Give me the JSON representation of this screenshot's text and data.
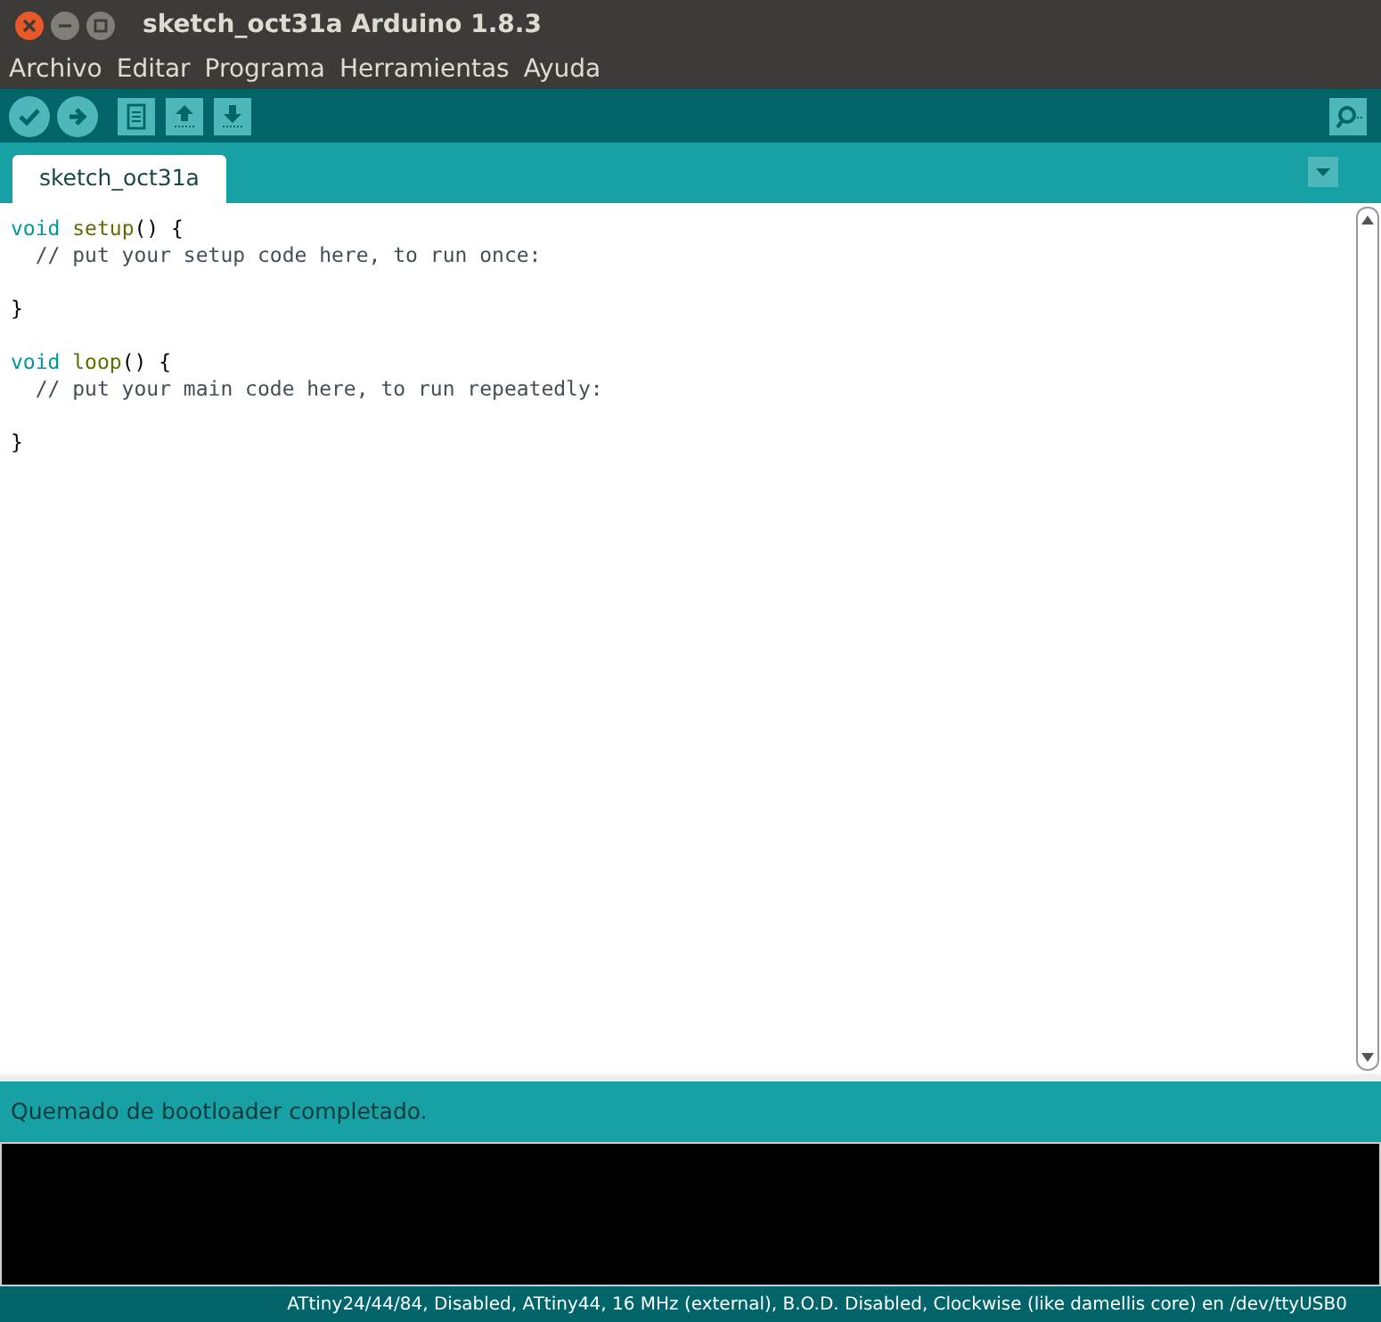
{
  "window": {
    "title": "sketch_oct31a Arduino 1.8.3"
  },
  "menu": [
    {
      "label": "Archivo"
    },
    {
      "label": "Editar"
    },
    {
      "label": "Programa"
    },
    {
      "label": "Herramientas"
    },
    {
      "label": "Ayuda"
    }
  ],
  "tabs": [
    {
      "label": "sketch_oct31a",
      "selected": true
    }
  ],
  "editor": {
    "tokens": [
      {
        "kind": "keyword",
        "text": "void"
      },
      {
        "kind": "function",
        "text": " setup"
      },
      {
        "kind": "plain",
        "text": "() {"
      },
      {
        "kind": "newline"
      },
      {
        "kind": "comment",
        "text": "  // put your setup code here, to run once:"
      },
      {
        "kind": "newline"
      },
      {
        "kind": "newline"
      },
      {
        "kind": "plain",
        "text": "}"
      },
      {
        "kind": "newline"
      },
      {
        "kind": "newline"
      },
      {
        "kind": "keyword",
        "text": "void"
      },
      {
        "kind": "function",
        "text": " loop"
      },
      {
        "kind": "plain",
        "text": "() {"
      },
      {
        "kind": "newline"
      },
      {
        "kind": "comment",
        "text": "  // put your main code here, to run repeatedly:"
      },
      {
        "kind": "newline"
      },
      {
        "kind": "newline"
      },
      {
        "kind": "plain",
        "text": "}"
      }
    ]
  },
  "status": {
    "message": "Quemado de bootloader completado."
  },
  "footer": {
    "board": "ATtiny24/44/84, Disabled, ATtiny44, 16 MHz (external), B.O.D. Disabled, Clockwise (like damellis core) en /dev/ttyUSB0"
  }
}
